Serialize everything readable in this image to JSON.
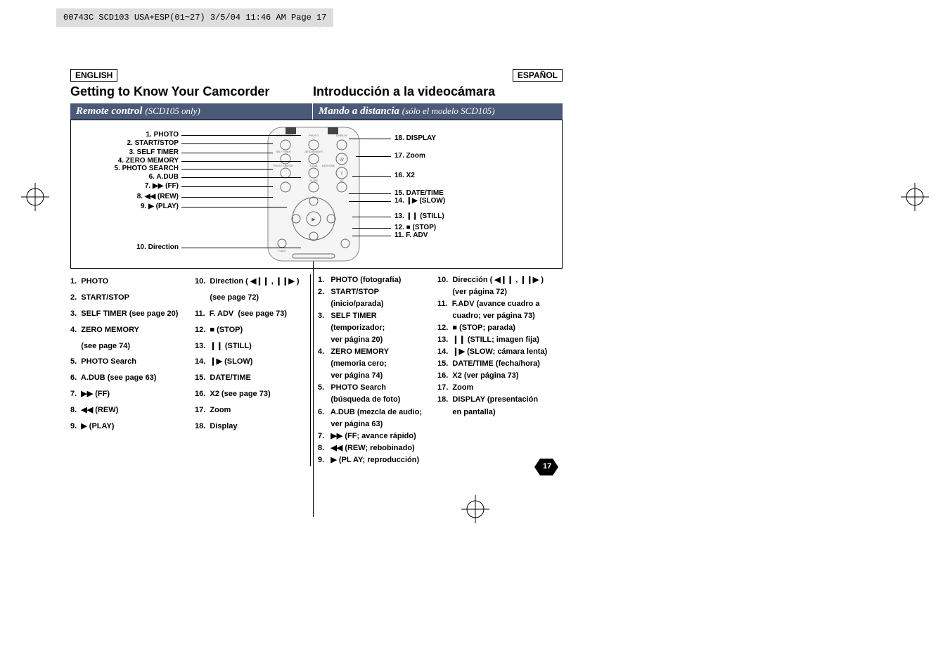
{
  "header": {
    "slug": "00743C SCD103 USA+ESP(01~27)  3/5/04 11:46 AM  Page 17"
  },
  "langs": {
    "en": "ENGLISH",
    "es": "ESPAÑOL"
  },
  "titles": {
    "en": "Getting to Know Your Camcorder",
    "es": "Introducción a la videocámara"
  },
  "sections": {
    "en_main": "Remote control",
    "en_sub": "(SCD105 only)",
    "es_main": "Mando a distancia",
    "es_sub": "(sólo el modelo SCD105)"
  },
  "diagram": {
    "left": {
      "l1": "1. PHOTO",
      "l2": "2. START/STOP",
      "l3": "3. SELF TIMER",
      "l4": "4. ZERO MEMORY",
      "l5": "5. PHOTO SEARCH",
      "l6": "6. A.DUB",
      "l7": "7. ▶▶ (FF)",
      "l8": "8. ◀◀ (REW)",
      "l9": "9. ▶ (PLAY)",
      "l10": "10. Direction"
    },
    "right": {
      "r18": "18. DISPLAY",
      "r17": "17. Zoom",
      "r16": "16. X2",
      "r15": "15. DATE/TIME",
      "r14": "14. ❙▶ (SLOW)",
      "r13": "13. ❙❙ (STILL)",
      "r12": "12. ■ (STOP)",
      "r11": "11. F. ADV"
    }
  },
  "list_en_a": [
    "1.  PHOTO",
    "2.  START/STOP",
    "3.  SELF TIMER (see page 20)",
    "4.  ZERO MEMORY",
    "     (see page 74)",
    "5.  PHOTO Search",
    "6.  A.DUB (see page 63)",
    "7.  ▶▶ (FF)",
    "8.  ◀◀ (REW)",
    "9.  ▶ (PLAY)"
  ],
  "list_en_b": [
    "10.  Direction ( ◀❙❙ , ❙❙▶ )",
    "       (see page 72)",
    "11.  F. ADV  (see page 73)",
    "12.  ■ (STOP)",
    "13.  ❙❙ (STILL)",
    "14.  ❙▶ (SLOW)",
    "15.  DATE/TIME",
    "16.  X2 (see page 73)",
    "17.  Zoom",
    "18.  Display"
  ],
  "list_es_a": [
    "1.   PHOTO (fotografía)",
    "2.   START/STOP",
    "      (inicio/parada)",
    "3.   SELF TIMER",
    "      (temporizador;",
    "      ver página 20)",
    "4.   ZERO MEMORY",
    "      (memoria cero;",
    "      ver página 74)",
    "5.   PHOTO Search",
    "      (búsqueda de foto)",
    "6.   A.DUB (mezcla de audio;",
    "      ver página 63)",
    "7.   ▶▶ (FF; avance rápido)",
    "8.   ◀◀ (REW; rebobinado)",
    "9.   ▶ (PL AY; reproducción)"
  ],
  "list_es_b": [
    "10.  Dirección ( ◀❙❙ , ❙❙▶ )",
    "       (ver página 72)",
    "11.  F.ADV (avance cuadro a",
    "       cuadro; ver página 73)",
    "12.  ■ (STOP; parada)",
    "13.  ❙❙ (STILL; imagen fija)",
    "14.  ❙▶ (SLOW; cámara lenta)",
    "15.  DATE/TIME (fecha/hora)",
    "16.  X2 (ver página 73)",
    "17.  Zoom",
    "18.  DISPLAY (presentación",
    "       en pantalla)"
  ],
  "page_number": "17"
}
